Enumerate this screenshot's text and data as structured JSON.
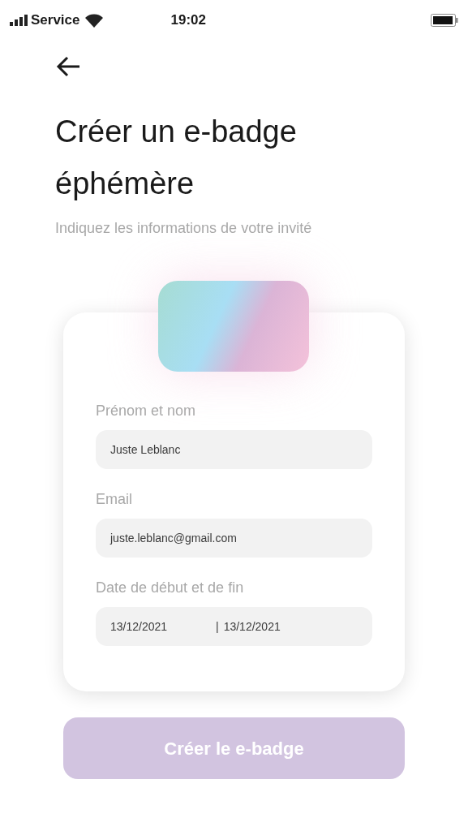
{
  "status_bar": {
    "carrier": "Service",
    "time": "19:02"
  },
  "title": "Créer un e-badge éphémère",
  "subtitle": "Indiquez les informations de votre invité",
  "form": {
    "fields": [
      {
        "kind": "text",
        "label": "Prénom et nom",
        "value": "Juste Leblanc"
      },
      {
        "kind": "text",
        "label": "Email",
        "value": "juste.leblanc@gmail.com"
      },
      {
        "kind": "range",
        "label": "Date de début et de fin",
        "start": "13/12/2021",
        "separator": "|",
        "end": "13/12/2021"
      }
    ]
  },
  "submit": {
    "label": "Créer le e-badge",
    "disabled": true
  }
}
